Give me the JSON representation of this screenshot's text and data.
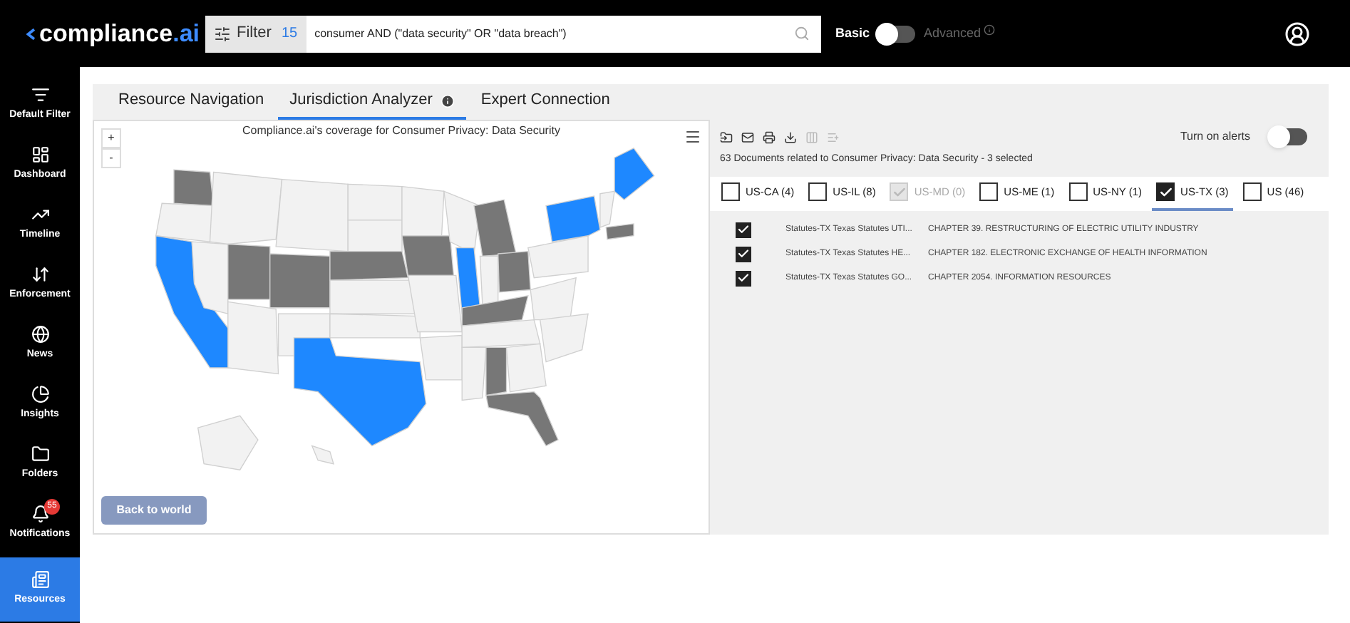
{
  "header": {
    "logo": {
      "name": "compliance",
      "suffix": ".ai"
    },
    "filter": {
      "label": "Filter",
      "count": "15",
      "value": "consumer AND (\"data security\" OR \"data breach\")"
    },
    "mode": {
      "basic": "Basic",
      "advanced": "Advanced",
      "advanced_on": false
    }
  },
  "sidebar": {
    "items": [
      {
        "kind": "filter",
        "label": "Default Filter",
        "selected": false
      },
      {
        "kind": "dashboard",
        "label": "Dashboard",
        "selected": false
      },
      {
        "kind": "timeline",
        "label": "Timeline",
        "selected": false
      },
      {
        "kind": "enforcement",
        "label": "Enforcement",
        "selected": false
      },
      {
        "kind": "news",
        "label": "News",
        "selected": false
      },
      {
        "kind": "insights",
        "label": "Insights",
        "selected": false
      },
      {
        "kind": "folders",
        "label": "Folders",
        "selected": false
      },
      {
        "kind": "notifications",
        "label": "Notifications",
        "selected": false,
        "badge": "55"
      },
      {
        "kind": "resources",
        "label": "Resources",
        "selected": true
      }
    ]
  },
  "tabs": [
    {
      "label": "Resource Navigation",
      "selected": false
    },
    {
      "label": "Jurisdiction Analyzer",
      "selected": true,
      "info": true
    },
    {
      "label": "Expert Connection",
      "selected": false
    }
  ],
  "map": {
    "title": "Compliance.ai's coverage for Consumer Privacy: Data Security",
    "zoom_in": "+",
    "zoom_out": "-",
    "back_button": "Back to world"
  },
  "documents": {
    "summary": "63 Documents related to Consumer Privacy: Data Security - 3 selected",
    "alerts": {
      "label": "Turn on alerts",
      "on": false
    },
    "jurisdictions": [
      {
        "label": "US-CA (4)",
        "checked": false,
        "disabled": false,
        "selected": false
      },
      {
        "label": "US-IL (8)",
        "checked": false,
        "disabled": false,
        "selected": false
      },
      {
        "label": "US-MD (0)",
        "checked": true,
        "disabled": true,
        "selected": false
      },
      {
        "label": "US-ME (1)",
        "checked": false,
        "disabled": false,
        "selected": false
      },
      {
        "label": "US-NY (1)",
        "checked": false,
        "disabled": false,
        "selected": false
      },
      {
        "label": "US-TX (3)",
        "checked": true,
        "disabled": false,
        "selected": true
      },
      {
        "label": "US (46)",
        "checked": false,
        "disabled": false,
        "selected": false
      }
    ],
    "rows": [
      {
        "checked": true,
        "source": "Statutes-TX Texas Statutes UTI...",
        "title": "CHAPTER 39. RESTRUCTURING OF ELECTRIC UTILITY INDUSTRY"
      },
      {
        "checked": true,
        "source": "Statutes-TX Texas Statutes HE...",
        "title": "CHAPTER 182. ELECTRONIC EXCHANGE OF HEALTH INFORMATION"
      },
      {
        "checked": true,
        "source": "Statutes-TX Texas Statutes GO...",
        "title": "CHAPTER 2054. INFORMATION RESOURCES"
      }
    ]
  }
}
